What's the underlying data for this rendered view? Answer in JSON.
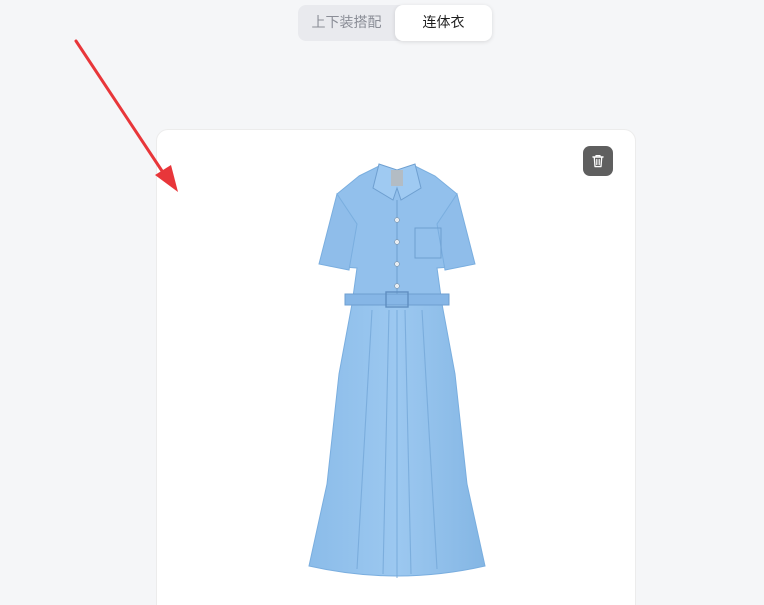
{
  "tabs": [
    {
      "label": "上下装搭配",
      "active": false
    },
    {
      "label": "连体衣",
      "active": true
    }
  ],
  "card": {
    "delete_icon": "trash-icon",
    "image": "blue-shirt-dress"
  },
  "annotation": {
    "arrow_color": "#e8363a"
  },
  "colors": {
    "dress": "#92c0ec",
    "background": "#f5f6f8",
    "trash_button": "#5f5f5f"
  }
}
